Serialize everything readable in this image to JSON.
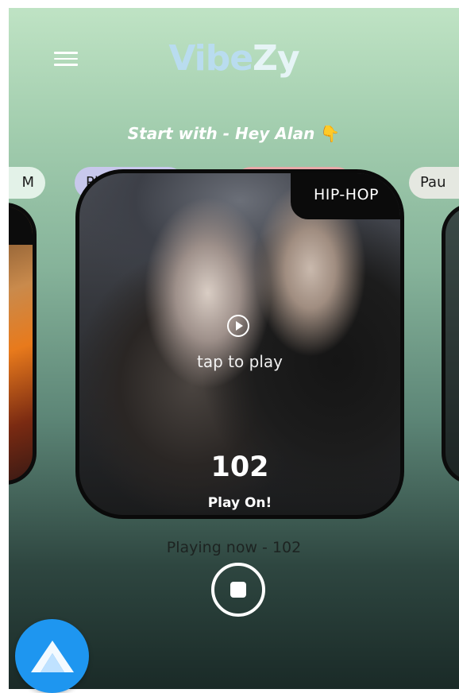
{
  "app": {
    "logo_part1": "Vibe",
    "logo_part2": "Zy",
    "subtitle": "Start with - Hey Alan",
    "subtitle_emoji": "👇"
  },
  "chips": [
    {
      "label": "M"
    },
    {
      "label": "Pl"
    },
    {
      "label": ""
    },
    {
      "label": "Pau"
    }
  ],
  "card": {
    "genre": "HIP-HOP",
    "tap_label": "tap to play",
    "station": "102",
    "cta": "Play On!"
  },
  "player": {
    "now_playing": "Playing now - 102"
  },
  "colors": {
    "fab": "#1e96f0",
    "chip_2": "#c8c8ec",
    "chip_3": "#e8a9a9"
  },
  "icons": {
    "menu": "hamburger-menu-icon",
    "play": "play-circle-icon",
    "stop": "stop-icon",
    "assistant": "alan-assistant-icon"
  }
}
